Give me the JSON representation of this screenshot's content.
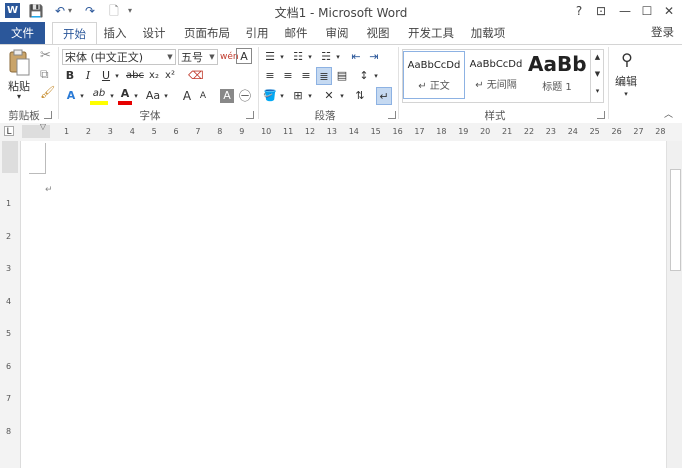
{
  "window": {
    "title": "文档1 - Microsoft Word",
    "help": "?",
    "controls": {
      "ribbon_display": "⊡",
      "minimize": "—",
      "maximize": "☐",
      "close": "✕"
    }
  },
  "quick_access": {
    "save": "💾",
    "undo": "↶",
    "undo_more": "▾",
    "redo": "↷",
    "print_preview": "🗋",
    "customize": "▾"
  },
  "tabs": [
    {
      "label": "文件"
    },
    {
      "label": "开始"
    },
    {
      "label": "插入"
    },
    {
      "label": "设计"
    },
    {
      "label": "页面布局"
    },
    {
      "label": "引用"
    },
    {
      "label": "邮件"
    },
    {
      "label": "审阅"
    },
    {
      "label": "视图"
    },
    {
      "label": "开发工具"
    },
    {
      "label": "加载项"
    }
  ],
  "login": "登录",
  "ribbon": {
    "clipboard": {
      "paste": "粘贴",
      "paste_arrow": "▾",
      "label": "剪贴板"
    },
    "font": {
      "font_name": "宋体 (中文正文)",
      "font_size": "五号",
      "grow": "A",
      "shrink": "A",
      "bold": "B",
      "italic": "I",
      "underline": "U",
      "strike": "abc",
      "subscript": "x₂",
      "superscript": "x²",
      "text_effects": "A",
      "highlight": "ab",
      "font_color": "A",
      "change_case": "Aa",
      "char_shading": "A",
      "enclose": "㊀",
      "pinyin": "wén",
      "char_border": "A",
      "label": "字体"
    },
    "paragraph": {
      "label": "段落"
    },
    "styles": {
      "items": [
        {
          "sample": "AaBbCcDd",
          "name": "↵ 正文"
        },
        {
          "sample": "AaBbCcDd",
          "name": "↵ 无间隔"
        },
        {
          "sample": "AaBb",
          "name": "标题 1"
        }
      ],
      "label": "样式"
    },
    "editing": {
      "label": "编辑"
    }
  },
  "ruler": {
    "h_ticks": [
      "1",
      "2",
      "3",
      "4",
      "5",
      "6",
      "7",
      "8",
      "9",
      "10",
      "11",
      "12",
      "13",
      "14",
      "15",
      "16",
      "17",
      "18",
      "19",
      "20",
      "21",
      "22",
      "23",
      "24",
      "25",
      "26",
      "27",
      "28"
    ],
    "v_ticks": [
      "1",
      "2",
      "3",
      "4",
      "5",
      "6",
      "7",
      "8"
    ]
  },
  "document": {
    "paragraph_mark": "↵"
  },
  "colors": {
    "accent": "#2b579a",
    "highlight": "#ffff00",
    "font_color": "#e60000"
  }
}
